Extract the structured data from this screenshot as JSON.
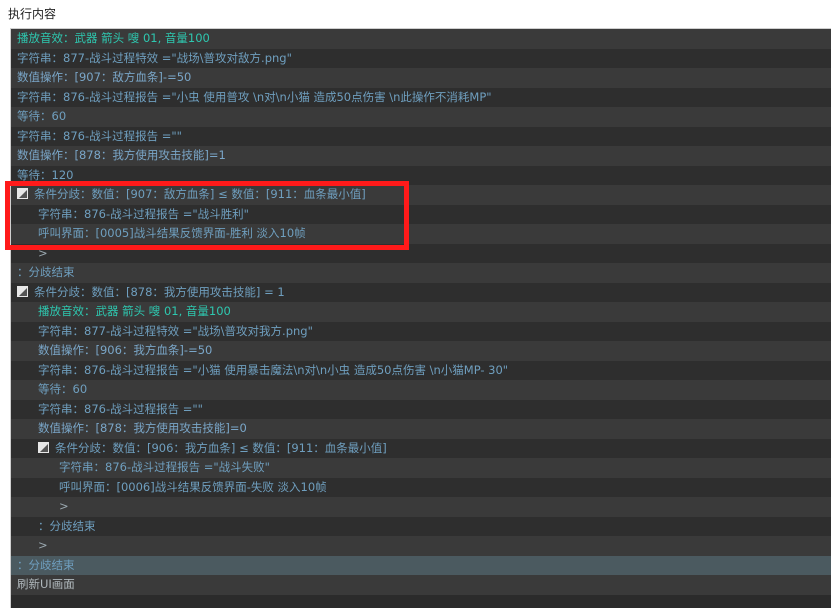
{
  "header": {
    "title": "执行内容"
  },
  "rows": [
    {
      "text": "播放音效：武器 箭头 嗖 01, 音量100",
      "cls": "t-sound",
      "indent": 0,
      "toggle": false
    },
    {
      "text": "字符串：877-战斗过程特效 =\"战场\\普攻对敌方.png\"",
      "cls": "t-str",
      "indent": 0,
      "toggle": false
    },
    {
      "text": "数值操作：[907：敌方血条]-=50",
      "cls": "t-num",
      "indent": 0,
      "toggle": false
    },
    {
      "text": "字符串：876-战斗过程报告 =\"小虫 使用普攻 \\n对\\n小猫 造成50点伤害 \\n此操作不消耗MP\"",
      "cls": "t-str",
      "indent": 0,
      "toggle": false
    },
    {
      "text": "等待：60",
      "cls": "t-wait",
      "indent": 0,
      "toggle": false
    },
    {
      "text": "字符串：876-战斗过程报告 =\"\"",
      "cls": "t-str",
      "indent": 0,
      "toggle": false
    },
    {
      "text": "数值操作：[878：我方使用攻击技能]=1",
      "cls": "t-num",
      "indent": 0,
      "toggle": false
    },
    {
      "text": "等待：120",
      "cls": "t-wait",
      "indent": 0,
      "toggle": false
    },
    {
      "text": "条件分歧：数值：[907：敌方血条] ≤ 数值：[911：血条最小值]",
      "cls": "t-cond",
      "indent": 0,
      "toggle": true
    },
    {
      "text": "字符串：876-战斗过程报告 =\"战斗胜利\"",
      "cls": "t-str",
      "indent": 1,
      "toggle": false
    },
    {
      "text": "呼叫界面：[0005]战斗结果反馈界面-胜利 淡入10帧",
      "cls": "t-call",
      "indent": 1,
      "toggle": false
    },
    {
      "text": ">",
      "cls": "t-arrow",
      "indent": 1,
      "toggle": false
    },
    {
      "text": "：分歧结束",
      "cls": "t-end",
      "indent": 0,
      "toggle": false
    },
    {
      "text": "条件分歧：数值：[878：我方使用攻击技能] = 1",
      "cls": "t-cond",
      "indent": 0,
      "toggle": true
    },
    {
      "text": "播放音效：武器 箭头 嗖 01, 音量100",
      "cls": "t-sound",
      "indent": 1,
      "toggle": false
    },
    {
      "text": "字符串：877-战斗过程特效 =\"战场\\普攻对我方.png\"",
      "cls": "t-str",
      "indent": 1,
      "toggle": false
    },
    {
      "text": "数值操作：[906：我方血条]-=50",
      "cls": "t-num",
      "indent": 1,
      "toggle": false
    },
    {
      "text": "字符串：876-战斗过程报告 =\"小猫 使用暴击魔法\\n对\\n小虫 造成50点伤害 \\n小猫MP- 30\"",
      "cls": "t-str",
      "indent": 1,
      "toggle": false
    },
    {
      "text": "等待：60",
      "cls": "t-wait",
      "indent": 1,
      "toggle": false
    },
    {
      "text": "字符串：876-战斗过程报告 =\"\"",
      "cls": "t-str",
      "indent": 1,
      "toggle": false
    },
    {
      "text": "数值操作：[878：我方使用攻击技能]=0",
      "cls": "t-num",
      "indent": 1,
      "toggle": false
    },
    {
      "text": "条件分歧：数值：[906：我方血条] ≤ 数值：[911：血条最小值]",
      "cls": "t-cond",
      "indent": 1,
      "toggle": true
    },
    {
      "text": "字符串：876-战斗过程报告 =\"战斗失败\"",
      "cls": "t-str",
      "indent": 2,
      "toggle": false
    },
    {
      "text": "呼叫界面：[0006]战斗结果反馈界面-失败 淡入10帧",
      "cls": "t-call",
      "indent": 2,
      "toggle": false
    },
    {
      "text": ">",
      "cls": "t-arrow",
      "indent": 2,
      "toggle": false
    },
    {
      "text": "：分歧结束",
      "cls": "t-end",
      "indent": 1,
      "toggle": false
    },
    {
      "text": ">",
      "cls": "t-arrow",
      "indent": 1,
      "toggle": false
    },
    {
      "text": "：分歧结束",
      "cls": "t-end",
      "indent": 0,
      "toggle": false,
      "selected": true
    },
    {
      "text": "刷新UI画面",
      "cls": "t-refresh",
      "indent": 0,
      "toggle": false
    }
  ]
}
